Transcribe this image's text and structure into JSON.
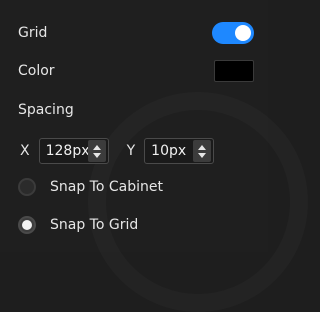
{
  "colors": {
    "accent": "#1e88ff",
    "background": "#1f1f1f",
    "swatch": "#000000"
  },
  "grid": {
    "label": "Grid",
    "enabled": true
  },
  "color": {
    "label": "Color",
    "value": "#000000"
  },
  "spacing": {
    "label": "Spacing",
    "x": {
      "label": "X",
      "value": "128px"
    },
    "y": {
      "label": "Y",
      "value": "10px"
    }
  },
  "snap": {
    "options": [
      {
        "label": "Snap To Cabinet",
        "checked": false
      },
      {
        "label": "Snap To Grid",
        "checked": true
      }
    ]
  }
}
